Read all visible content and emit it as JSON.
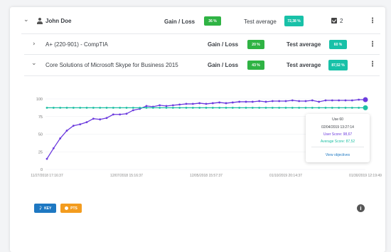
{
  "user_row": {
    "name": "John Doe",
    "gain_loss_label": "Gain / Loss",
    "gain_loss_value": "36 %",
    "test_average_label": "Test average",
    "test_average_value": "72,38 %",
    "completed_count": "2",
    "icons": [
      "chevron-down-icon",
      "user-icon",
      "checkbox-icon",
      "kebab-menu-icon"
    ]
  },
  "course_rows": [
    {
      "title": "A+ (220-901) - CompTIA",
      "gain_loss_label": "Gain / Loss",
      "gain_loss_value": "20 %",
      "test_average_label": "Test average",
      "test_average_value": "60 %",
      "expanded": false
    },
    {
      "title": "Core Solutions of Microsoft Skype for Business 2015",
      "gain_loss_label": "Gain / Loss",
      "gain_loss_value": "43 %",
      "test_average_label": "Test average",
      "test_average_value": "87,52 %",
      "expanded": true
    }
  ],
  "colors": {
    "gain_badge": "#2fb344",
    "average_badge": "#18c1a8",
    "user_score_line": "#6c3bde",
    "average_line": "#1fc0a4",
    "key_button": "#1e78c2",
    "pts_button": "#f39c1f"
  },
  "chart_data": {
    "type": "line",
    "y_ticks": [
      "100",
      "75",
      "50",
      "25",
      "0"
    ],
    "ylim": [
      0,
      100
    ],
    "x_tick_labels": [
      "11/27/2018 17:16:37",
      "12/07/2018 15:16:37",
      "12/05/2018 15:57:37",
      "01/10/2019 20:14:37",
      "01/30/2019 12:19:49"
    ],
    "grid": true,
    "series": [
      {
        "name": "User Score",
        "values": [
          15,
          30,
          44,
          55,
          62,
          64,
          67,
          72,
          71,
          73,
          78,
          78,
          79,
          84,
          86,
          90,
          89,
          91,
          90,
          91,
          92,
          93,
          93,
          94,
          93,
          94,
          95,
          94,
          95,
          96,
          96,
          96,
          97,
          96,
          97,
          97,
          97,
          98,
          97,
          97,
          98,
          96,
          98,
          98,
          98,
          98,
          98,
          99,
          99
        ]
      },
      {
        "name": "Average Score",
        "values": [
          87.52,
          87.52,
          87.52,
          87.52,
          87.52,
          87.52,
          87.52,
          87.52,
          87.52,
          87.52,
          87.52,
          87.52,
          87.52,
          87.52,
          87.52,
          87.52,
          87.52,
          87.52,
          87.52,
          87.52,
          87.52,
          87.52,
          87.52,
          87.52,
          87.52,
          87.52,
          87.52,
          87.52,
          87.52,
          87.52,
          87.52,
          87.52,
          87.52,
          87.52,
          87.52,
          87.52,
          87.52,
          87.52,
          87.52,
          87.52,
          87.52,
          87.52,
          87.52,
          87.52,
          87.52,
          87.52,
          87.52,
          87.52,
          87.52
        ]
      }
    ]
  },
  "tooltip": {
    "title": "Use 60",
    "date": "02/04/2019 13:27:14",
    "user_score": "User Score: 98,67",
    "average_score": "Average Score: 87,52",
    "link": "View objectives"
  },
  "footer": {
    "key_label": "KEY",
    "pts_label": "PTS"
  }
}
